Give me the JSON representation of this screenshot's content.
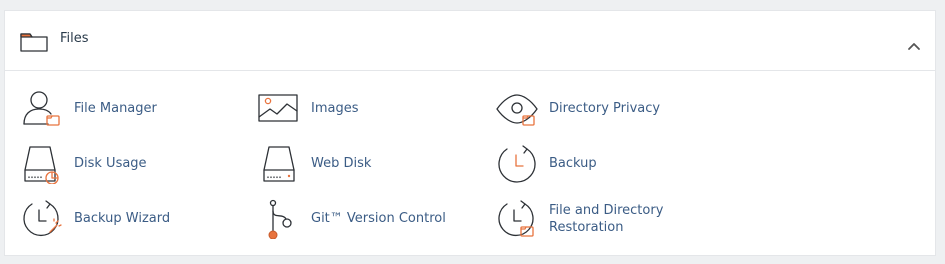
{
  "panel": {
    "title": "Files",
    "header_icon": "folder-icon",
    "collapse_icon": "chevron-up-icon"
  },
  "colors": {
    "accent": "#e8733e",
    "link": "#3b5c85",
    "icon_stroke": "#2d3136",
    "panel_bg": "#ffffff",
    "page_bg": "#eef0f2"
  },
  "items": [
    {
      "label": "File Manager",
      "icon": "file-manager-icon"
    },
    {
      "label": "Images",
      "icon": "images-icon"
    },
    {
      "label": "Directory Privacy",
      "icon": "directory-privacy-icon"
    },
    {
      "label": "Disk Usage",
      "icon": "disk-usage-icon"
    },
    {
      "label": "Web Disk",
      "icon": "web-disk-icon"
    },
    {
      "label": "Backup",
      "icon": "backup-icon"
    },
    {
      "label": "Backup Wizard",
      "icon": "backup-wizard-icon"
    },
    {
      "label": "Git™ Version Control",
      "icon": "git-version-control-icon"
    },
    {
      "label": "File and Directory Restoration",
      "icon": "file-directory-restoration-icon"
    }
  ]
}
